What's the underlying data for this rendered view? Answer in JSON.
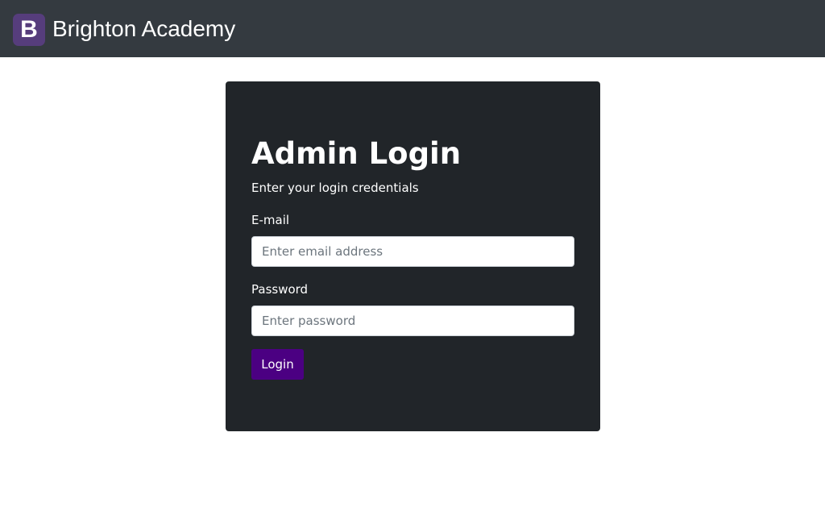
{
  "navbar": {
    "logo_letter": "B",
    "brand_name": "Brighton Academy",
    "background_color": "#343a40",
    "logo_color": "#563d7c"
  },
  "login_card": {
    "title": "Admin Login",
    "subtitle": "Enter your login credentials",
    "background_color": "#212529",
    "email": {
      "label": "E-mail",
      "value": "",
      "placeholder": "Enter email address"
    },
    "password": {
      "label": "Password",
      "value": "",
      "placeholder": "Enter password"
    },
    "submit_label": "Login",
    "button_color": "#4b0082"
  }
}
